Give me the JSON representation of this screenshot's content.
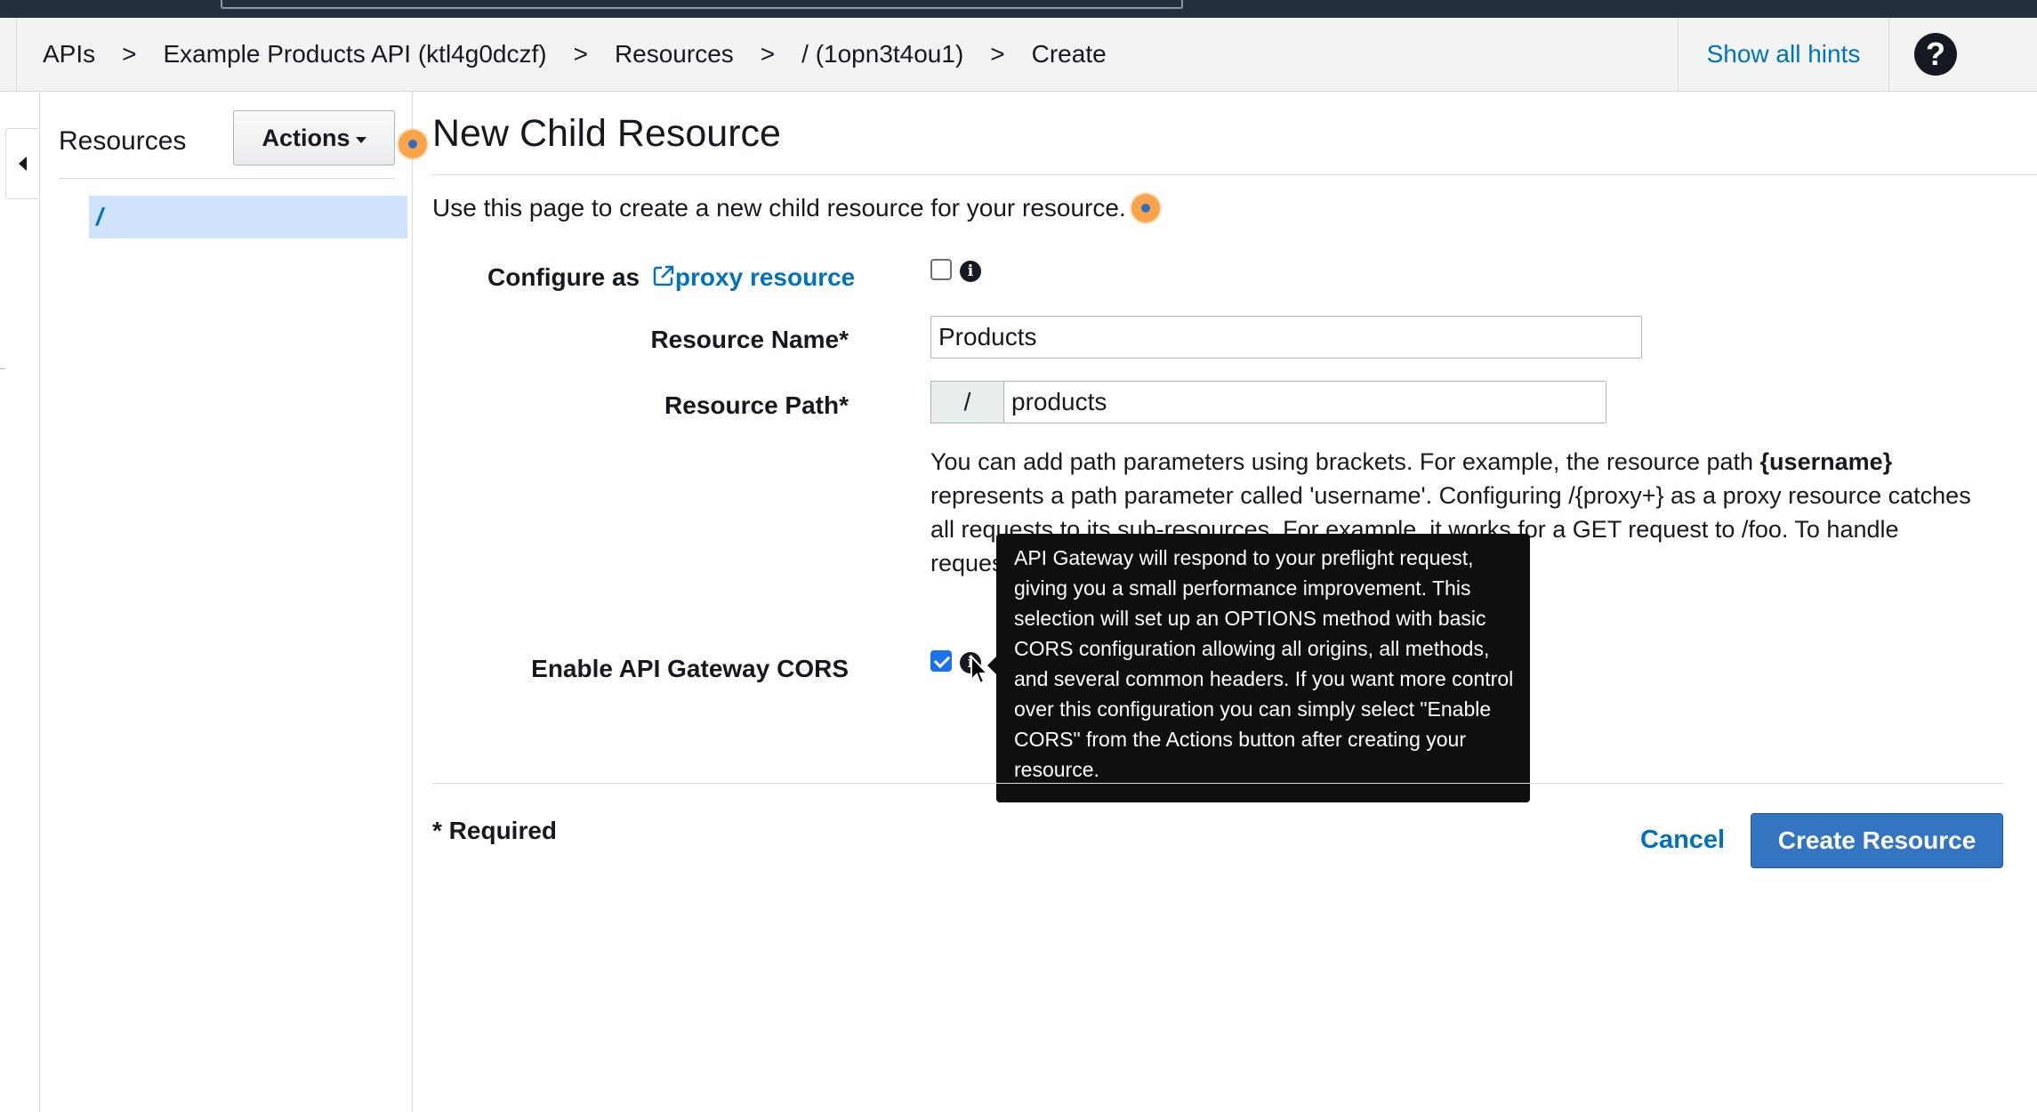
{
  "breadcrumb": {
    "items": [
      "APIs",
      "Example Products API (ktl4g0dczf)",
      "Resources",
      "/ (1opn3t4ou1)",
      "Create"
    ],
    "separator": ">"
  },
  "header": {
    "show_hints_label": "Show all hints",
    "help_glyph": "?"
  },
  "sidebar": {
    "title": "Resources",
    "actions_label": "Actions",
    "tree_root": "/"
  },
  "main": {
    "title": "New Child Resource",
    "intro": "Use this page to create a new child resource for your resource."
  },
  "form": {
    "proxy_label_prefix": "Configure as ",
    "proxy_link_text": "proxy resource",
    "proxy_checked": false,
    "resource_name_label": "Resource Name*",
    "resource_name_value": "Products",
    "resource_path_label": "Resource Path*",
    "resource_path_prefix": "/",
    "resource_path_value": "products",
    "path_help_1": "You can add path parameters using brackets. For example, the resource path ",
    "path_help_bold": "{username}",
    "path_help_2": " represents a path parameter called 'username'. Configuring /{proxy+} as a proxy resource catches all requests to its sub-resources. For example, it works for a GET request to /foo. To handle requests to /, add a new ANY method on the / resource.",
    "cors_label": "Enable API Gateway CORS",
    "cors_checked": true
  },
  "tooltip": {
    "text": "API Gateway will respond to your preflight request, giving you a small performance improvement. This selection will set up an OPTIONS method with basic CORS configuration allowing all origins, all methods, and several common headers. If you want more control over this configuration you can simply select \"Enable CORS\" from the Actions button after creating your resource."
  },
  "footer": {
    "required_note": "* Required",
    "cancel_label": "Cancel",
    "create_label": "Create Resource"
  },
  "icons": {
    "info": "info-icon",
    "external_link": "external-link-icon",
    "help": "question-circle-icon",
    "hint": "hint-beacon-icon"
  },
  "colors": {
    "accent": "#0073bb",
    "primary_button": "#3475c2",
    "topbar": "#232f3e",
    "tooltip_bg": "#0f0f0f",
    "hint_orange": "#f7a44a"
  }
}
